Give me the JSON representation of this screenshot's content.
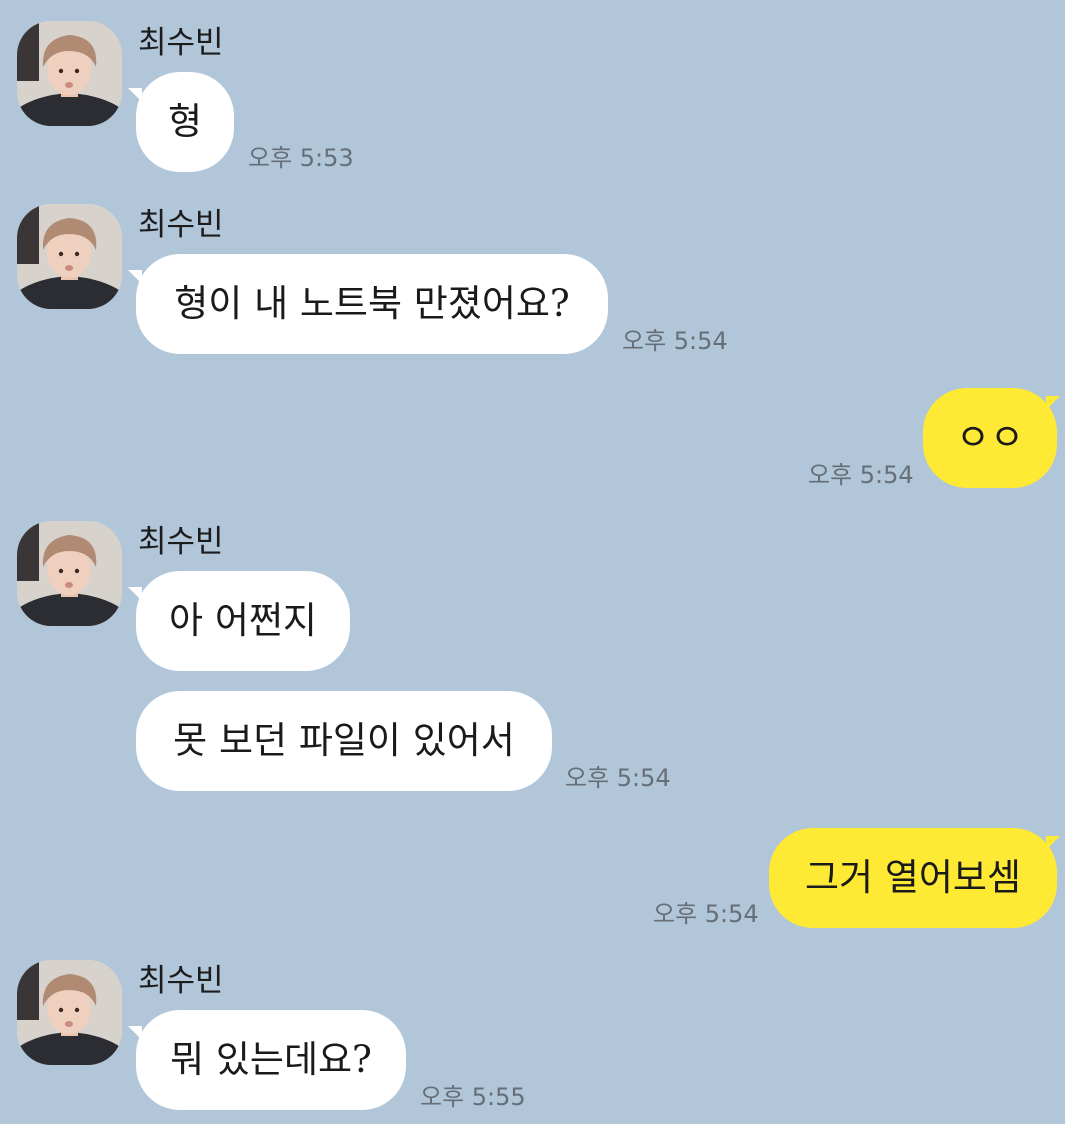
{
  "chat": {
    "sender_name": "최수빈",
    "messages": [
      {
        "sender": "최수빈",
        "text": "형",
        "time": "오후 5:53"
      },
      {
        "sender": "최수빈",
        "text": "형이 내 노트북 만졌어요?",
        "time": "오후 5:54"
      },
      {
        "sender": "me",
        "text": "ㅇㅇ",
        "time": "오후 5:54"
      },
      {
        "sender": "최수빈",
        "text": "아 어쩐지",
        "time": ""
      },
      {
        "sender": "최수빈",
        "text": "못 보던 파일이 있어서",
        "time": "오후 5:54"
      },
      {
        "sender": "me",
        "text": "그거 열어보셈",
        "time": "오후 5:54"
      },
      {
        "sender": "최수빈",
        "text": "뭐 있는데요?",
        "time": "오후 5:55"
      }
    ]
  },
  "colors": {
    "background": "#b1c6d9",
    "incoming_bubble": "#ffffff",
    "outgoing_bubble": "#fee934",
    "timestamp": "#666f78"
  },
  "icons": {
    "avatar": "profile-photo"
  }
}
